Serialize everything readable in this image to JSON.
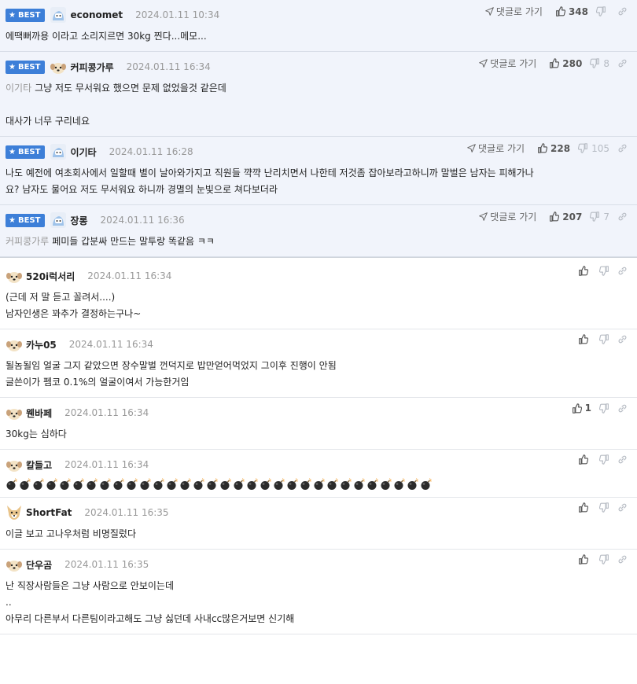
{
  "labels": {
    "best": "BEST",
    "goto": "댓글로 가기"
  },
  "best_comments": [
    {
      "nick": "economet",
      "date": "2024.01.11 10:34",
      "up": "348",
      "down": "",
      "ref": "",
      "lines": [
        "에땍뻐까용 이라고 소리지르면 30kg 찐다...메모..."
      ]
    },
    {
      "nick": "커피콩가루",
      "date": "2024.01.11 16:34",
      "up": "280",
      "down": "8",
      "ref": "이기타",
      "lines": [
        "그냥 저도 무서워요 했으면 문제 없었을것 같은데",
        "",
        "대사가 너무 구리네요"
      ]
    },
    {
      "nick": "이기타",
      "date": "2024.01.11 16:28",
      "up": "228",
      "down": "105",
      "ref": "",
      "lines": [
        "나도 예전에 여초회사에서 일할때 별이 날아와가지고 직원들 꺅꺅 난리치면서 나한테 저것좀 잡아보라고하니까 말벌은 남자는 피해가나",
        "요? 남자도 물어요 저도 무서워요 하니까 경멸의 눈빛으로 쳐다보더라"
      ]
    },
    {
      "nick": "장롱",
      "date": "2024.01.11 16:36",
      "up": "207",
      "down": "7",
      "ref": "커피콩가루",
      "lines": [
        "페미들 갑분싸 만드는 말투랑 똑같음 ㅋㅋ"
      ]
    }
  ],
  "comments": [
    {
      "nick": "520i럭서리",
      "date": "2024.01.11 16:34",
      "up": "",
      "lines": [
        "(근데 저 말 듣고 꼴려서....)",
        "남자인생은 꽈추가 결정하는구나~"
      ]
    },
    {
      "nick": "카누05",
      "date": "2024.01.11 16:34",
      "up": "",
      "lines": [
        "될놈될임 얼굴 그지 같았으면 장수말벌 껀덕지로 밥만얻어먹었지 그이후 진행이 안됨",
        "글쓴이가 펨코 0.1%의 얼굴이여서 가능한거임"
      ]
    },
    {
      "nick": "웬바페",
      "date": "2024.01.11 16:34",
      "up": "1",
      "lines": [
        "30kg는 심하다"
      ]
    },
    {
      "nick": "칼들고",
      "date": "2024.01.11 16:34",
      "up": "",
      "lines": []
    },
    {
      "nick": "ShortFat",
      "date": "2024.01.11 16:35",
      "up": "",
      "lines": [
        "이글 보고 고나우처럼 비명질렀다"
      ]
    },
    {
      "nick": "단우곰",
      "date": "2024.01.11 16:35",
      "up": "",
      "lines": [
        "난 직장사람들은 그냥 사람으로 안보이는데",
        "..",
        "아무리 다른부서 다른팀이라고해도 그냥 싫던데 사내cc많은거보면 신기해"
      ]
    }
  ],
  "bomb_count": 32,
  "colors": {
    "badge": "#3d7fd8",
    "best_bg": "#f1f4fb"
  }
}
